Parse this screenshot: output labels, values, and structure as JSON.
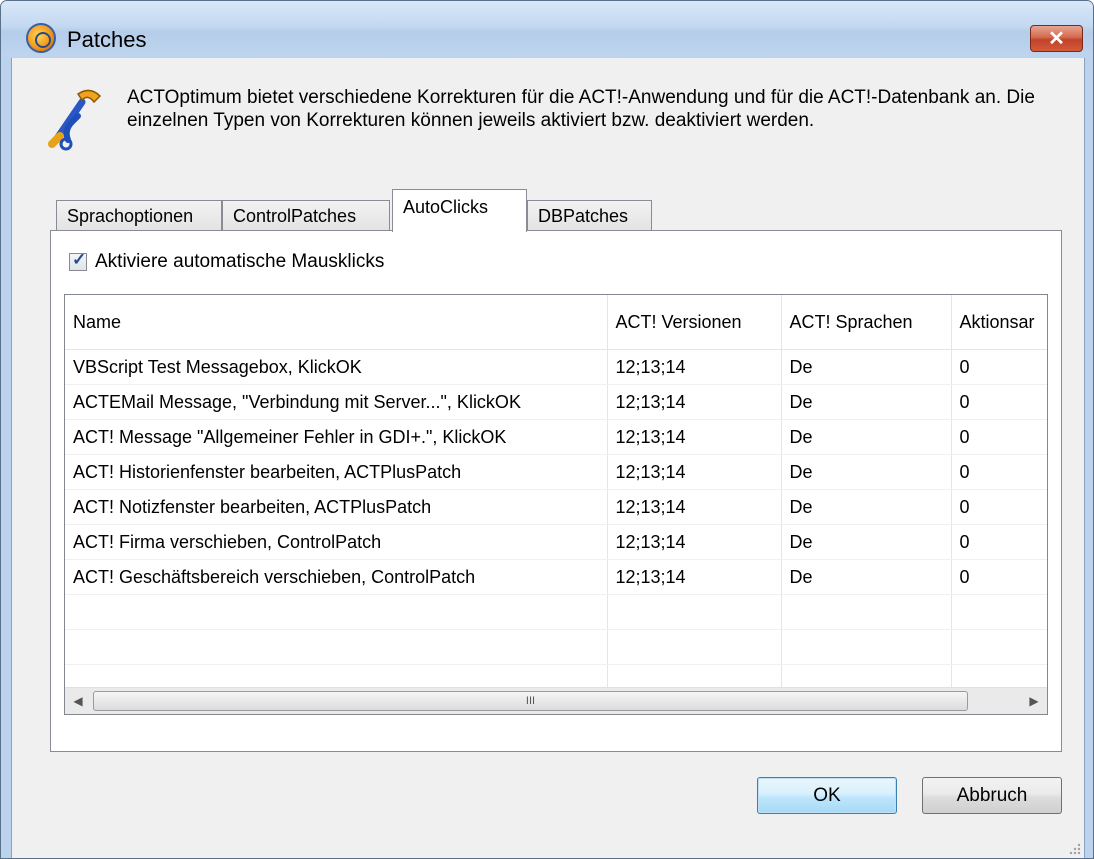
{
  "window": {
    "title": "Patches",
    "close_label": "✕"
  },
  "description": "ACTOptimum bietet verschiedene Korrekturen für die ACT!-Anwendung und für die ACT!-Datenbank an. Die einzelnen Typen von Korrekturen können jeweils aktiviert bzw. deaktiviert werden.",
  "tabs": [
    {
      "label": "Sprachoptionen",
      "active": false
    },
    {
      "label": "ControlPatches",
      "active": false
    },
    {
      "label": "AutoClicks",
      "active": true
    },
    {
      "label": "DBPatches",
      "active": false
    }
  ],
  "autoclicks": {
    "checkbox_label": "Aktiviere automatische Mausklicks",
    "checked": true,
    "columns": [
      "Name",
      "ACT! Versionen",
      "ACT! Sprachen",
      "Aktionsar"
    ],
    "rows": [
      [
        "VBScript Test Messagebox, KlickOK",
        "12;13;14",
        "De",
        "0"
      ],
      [
        "ACTEMail Message, \"Verbindung mit Server...\", KlickOK",
        "12;13;14",
        "De",
        "0"
      ],
      [
        "ACT! Message \"Allgemeiner Fehler in GDI+.\", KlickOK",
        "12;13;14",
        "De",
        "0"
      ],
      [
        "ACT! Historienfenster bearbeiten, ACTPlusPatch",
        "12;13;14",
        "De",
        "0"
      ],
      [
        "ACT! Notizfenster bearbeiten, ACTPlusPatch",
        "12;13;14",
        "De",
        "0"
      ],
      [
        "ACT! Firma verschieben, ControlPatch",
        "12;13;14",
        "De",
        "0"
      ],
      [
        "ACT! Geschäftsbereich verschieben, ControlPatch",
        "12;13;14",
        "De",
        "0"
      ]
    ],
    "empty_rows": 3,
    "scroll_left": "◀",
    "scroll_right": "▶",
    "scroll_grip": "III"
  },
  "buttons": {
    "ok": "OK",
    "cancel": "Abbruch"
  },
  "icons": {
    "app": "act-optimum-icon",
    "tools": "tools-icon",
    "checkbox": "checkmark-icon"
  },
  "colors": {
    "accent": "#3c7fb1",
    "close": "#c1432a"
  }
}
